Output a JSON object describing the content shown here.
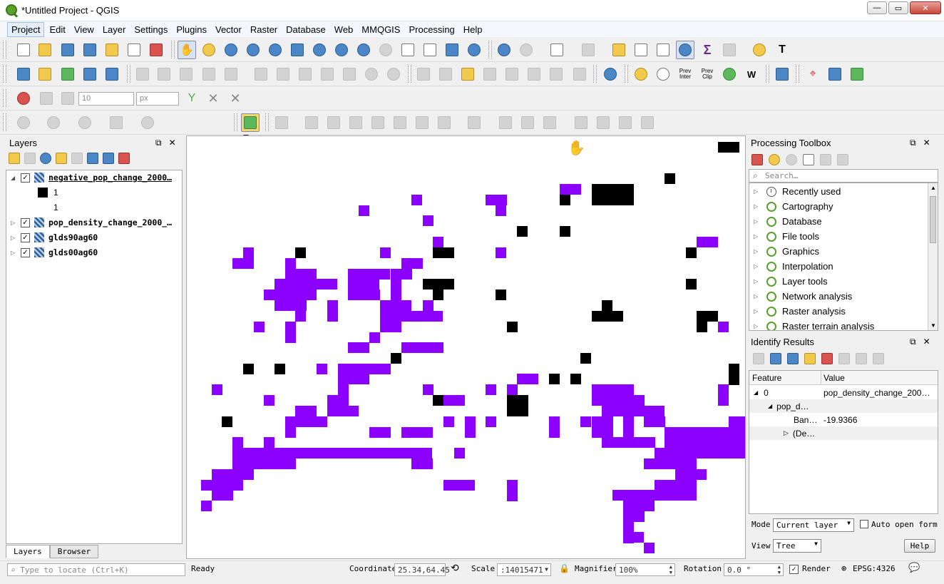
{
  "window": {
    "title": "*Untitled Project - QGIS",
    "minimize": "—",
    "maximize": "▭",
    "close": "✕"
  },
  "menu": [
    "Project",
    "Edit",
    "View",
    "Layer",
    "Settings",
    "Plugins",
    "Vector",
    "Raster",
    "Database",
    "Web",
    "MMQGIS",
    "Processing",
    "Help"
  ],
  "toolbar3": {
    "snap_tolerance": "10",
    "snap_units": "px"
  },
  "toolbar2": {
    "prev_inter": "Prev\nInter",
    "prev_clip": "Prev\nClip"
  },
  "layers_panel": {
    "title": "Layers",
    "layers": [
      {
        "name": "negative_pop_change_2000…",
        "checked": true,
        "expanded": true,
        "legend": [
          {
            "label": "1",
            "color": "#000000"
          },
          {
            "label": "1",
            "color": "#ffffff"
          }
        ]
      },
      {
        "name": "pop_density_change_2000_…",
        "checked": true,
        "expanded": false
      },
      {
        "name": "glds90ag60",
        "checked": true,
        "expanded": false
      },
      {
        "name": "glds00ag60",
        "checked": true,
        "expanded": false
      }
    ],
    "tabs": [
      "Layers",
      "Browser"
    ]
  },
  "map": {
    "purple": "#8b00ff",
    "black": "#000000",
    "cursor": "hand"
  },
  "processing": {
    "title": "Processing Toolbox",
    "search_placeholder": "Search…",
    "items": [
      "Recently used",
      "Cartography",
      "Database",
      "File tools",
      "Graphics",
      "Interpolation",
      "Layer tools",
      "Network analysis",
      "Raster analysis",
      "Raster terrain analysis"
    ]
  },
  "identify": {
    "title": "Identify Results",
    "col_feature": "Feature",
    "col_value": "Value",
    "rows": [
      {
        "feature": "0",
        "value": "pop_density_change_200…"
      },
      {
        "feature": "pop_d…",
        "value": ""
      },
      {
        "feature": "Ban…",
        "value": "-19.9366"
      },
      {
        "feature": "(De…",
        "value": ""
      }
    ],
    "mode_label": "Mode",
    "mode_value": "Current layer",
    "auto_open": "Auto open form",
    "view_label": "View",
    "view_value": "Tree",
    "help": "Help"
  },
  "status": {
    "locate_placeholder": "Type to locate (Ctrl+K)",
    "ready": "Ready",
    "coord_label": "Coordinate",
    "coord_value": "25.34,64.45",
    "scale_label": "Scale",
    "scale_value": ":14015471",
    "magnifier_label": "Magnifier",
    "magnifier_value": "100%",
    "rotation_label": "Rotation",
    "rotation_value": "0.0 °",
    "render_label": "Render",
    "crs": "EPSG:4326"
  }
}
